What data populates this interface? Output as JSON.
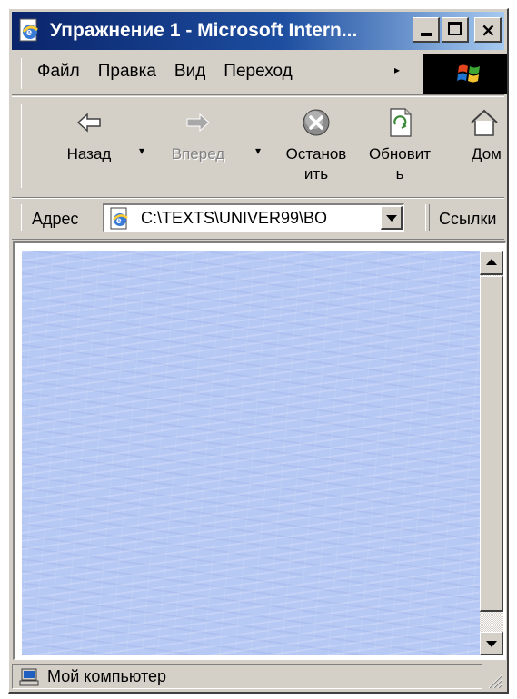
{
  "window": {
    "title": "Упражнение 1 - Microsoft Intern...",
    "minimize_label": "",
    "maximize_label": "",
    "close_label": "×"
  },
  "menu": {
    "items": [
      {
        "label": "Файл"
      },
      {
        "label": "Правка"
      },
      {
        "label": "Вид"
      },
      {
        "label": "Переход"
      }
    ],
    "more_glyph": "▸"
  },
  "toolbar": {
    "back_label": "Назад",
    "forward_label": "Вперед",
    "stop_label_line1": "Останов",
    "stop_label_line2": "ить",
    "refresh_label_line1": "Обновит",
    "refresh_label_line2": "ь",
    "home_label": "Дом",
    "dropdown_glyph": "▾"
  },
  "address": {
    "label": "Адрес",
    "value": "C:\\TEXTS\\UNIVER99\\BO",
    "links_label": "Ссылки"
  },
  "status": {
    "text": "Мой компьютер"
  },
  "colors": {
    "titlebar_start": "#0a246a",
    "titlebar_end": "#a6caf0",
    "chrome": "#d4d0c8",
    "page_background": "#b6c8f4"
  }
}
